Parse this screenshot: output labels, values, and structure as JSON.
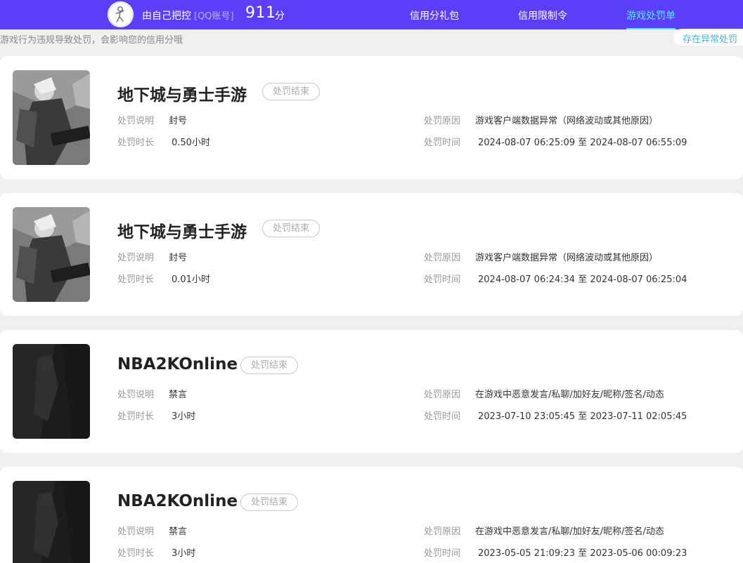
{
  "header": {
    "user_name": "由自己把控",
    "account_tag": "[QQ账号]",
    "score": "911",
    "score_unit": "分",
    "nav": [
      {
        "label": "信用分礼包"
      },
      {
        "label": "信用限制令"
      },
      {
        "label": "游戏处罚单"
      }
    ],
    "active_tab_index": 2,
    "accent_color": "#5b3ff8",
    "active_color": "#58e6ff"
  },
  "notice_text": "游戏行为违规导致处罚，会影响您的信用分哦",
  "anomaly_link": "存在异常处罚",
  "field_labels": {
    "desc": "处罚说明",
    "duration": "处罚时长",
    "reason": "处罚原因",
    "time": "处罚时间"
  },
  "records": [
    {
      "game": "地下城与勇士手游",
      "thumbnail_icon": "dnf-hero-art",
      "status": "处罚结束",
      "desc": "封号",
      "duration": "0.50小时",
      "reason": "游戏客户端数据异常（网络波动或其他原因）",
      "time": "2024-08-07 06:25:09 至 2024-08-07 06:55:09"
    },
    {
      "game": "地下城与勇士手游",
      "thumbnail_icon": "dnf-hero-art",
      "status": "处罚结束",
      "desc": "封号",
      "duration": "0.01小时",
      "reason": "游戏客户端数据异常（网络波动或其他原因）",
      "time": "2024-08-07 06:24:34 至 2024-08-07 06:25:04"
    },
    {
      "game": "NBA2KOnline",
      "thumbnail_icon": "nba2k-dark-art",
      "status": "处罚结束",
      "desc": "禁言",
      "duration": "3小时",
      "reason": "在游戏中恶意发言/私聊/加好友/昵称/签名/动态",
      "time": "2023-07-10 23:05:45 至 2023-07-11 02:05:45"
    },
    {
      "game": "NBA2KOnline",
      "thumbnail_icon": "nba2k-dark-art",
      "status": "处罚结束",
      "desc": "禁言",
      "duration": "3小时",
      "reason": "在游戏中恶意发言/私聊/加好友/昵称/签名/动态",
      "time": "2023-05-05 21:09:23 至 2023-05-06 00:09:23"
    }
  ]
}
